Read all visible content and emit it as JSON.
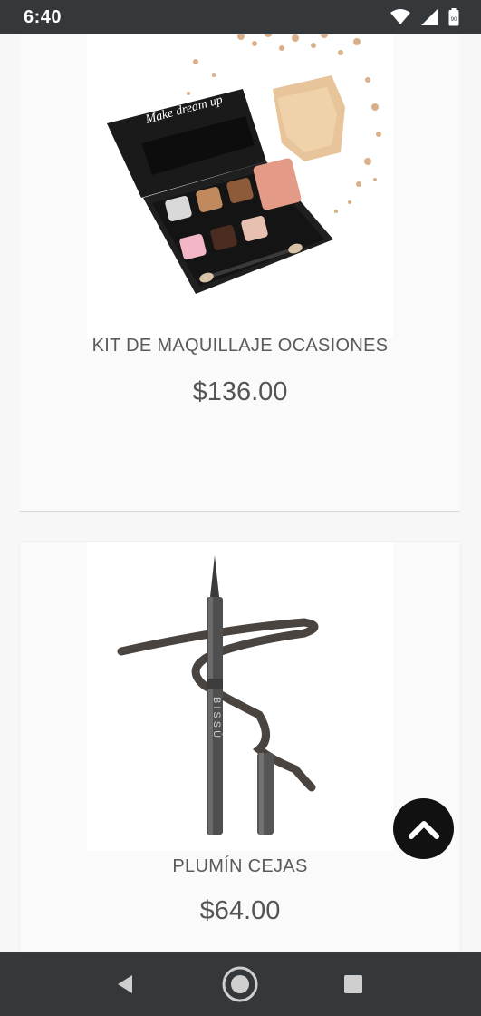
{
  "status_bar": {
    "time": "6:40",
    "battery_level": "90",
    "icons": [
      "wifi-icon",
      "signal-icon",
      "battery-icon"
    ]
  },
  "products": [
    {
      "name": "KIT DE MAQUILLAJE OCASIONES",
      "price": "$136.00",
      "image": "eyeshadow-palette-image"
    },
    {
      "name": "PLUMÍN CEJAS",
      "price": "$64.00",
      "image": "eyebrow-pen-image"
    }
  ],
  "palette_label": "Make dream up",
  "pen_brand": "BISSÚ",
  "scroll_top_icon": "chevron-up-icon",
  "nav_bar": {
    "buttons": [
      "back-icon",
      "home-icon",
      "recents-icon"
    ]
  },
  "colors": {
    "status_bar": "#35383b",
    "nav_bar": "#35383b",
    "scroll_button": "#111111",
    "text": "#5a5a5a"
  }
}
